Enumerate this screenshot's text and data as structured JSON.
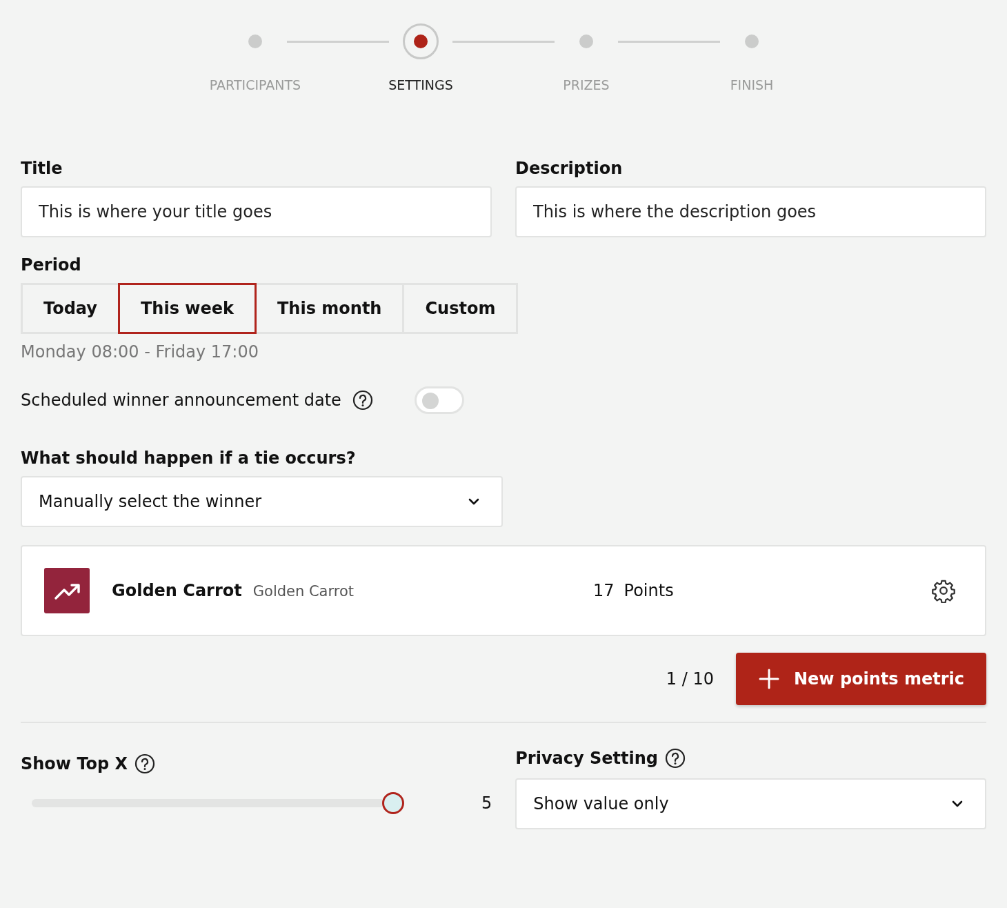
{
  "stepper": [
    {
      "label": "PARTICIPANTS",
      "selected": false
    },
    {
      "label": "SETTINGS",
      "selected": true
    },
    {
      "label": "PRIZES",
      "selected": false
    },
    {
      "label": "FINISH",
      "selected": false
    }
  ],
  "title_field": {
    "label": "Title",
    "placeholder": "This is where your title goes"
  },
  "description_field": {
    "label": "Description",
    "placeholder": "This is where the description goes"
  },
  "period": {
    "label": "Period",
    "options": [
      {
        "label": "Today",
        "selected": false
      },
      {
        "label": "This week",
        "selected": true
      },
      {
        "label": "This month",
        "selected": false
      },
      {
        "label": "Custom",
        "selected": false
      }
    ],
    "range": "Monday 08:00 - Friday 17:00"
  },
  "announcement": {
    "label": "Scheduled winner announcement date",
    "on": false
  },
  "tie": {
    "label": "What should happen if a tie occurs?",
    "value": "Manually select the winner"
  },
  "metric": {
    "name": "Golden Carrot",
    "subtitle": "Golden Carrot",
    "value": "17",
    "unit": "Points"
  },
  "metric_count": "1 / 10",
  "new_metric_button": "New points metric",
  "show_top": {
    "label": "Show Top X",
    "level": 1,
    "value": "5"
  },
  "privacy": {
    "label": "Privacy Setting",
    "value": "Show value only"
  }
}
